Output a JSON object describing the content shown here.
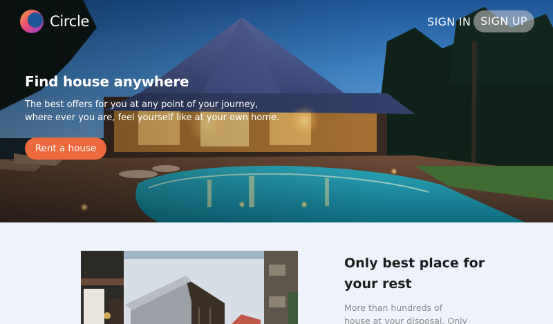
{
  "brand": {
    "name": "Circle"
  },
  "nav": {
    "sign_in": "SIGN IN",
    "sign_up": "SIGN UP"
  },
  "hero": {
    "title": "Find house anywhere",
    "subtitle_line1": "The best offers for you at any point of your journey,",
    "subtitle_line2": "where ever you are, feel yourself like at your own home.",
    "cta": "Rent a house"
  },
  "section": {
    "title_line1": "Only best place for",
    "title_line2": "your rest",
    "text_line1": "More than hundreds of",
    "text_line2": "house at your disposal. Only"
  },
  "colors": {
    "accent": "#ed6a3e",
    "section_bg": "#eef2fb",
    "logo_gradient": [
      "#f4a13a",
      "#e8467a",
      "#8b3fd6"
    ]
  }
}
